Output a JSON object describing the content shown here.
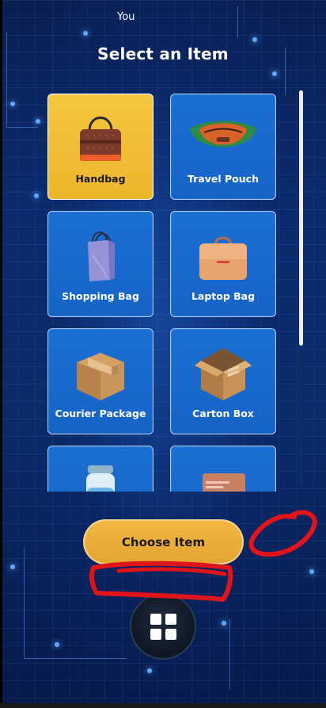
{
  "header": {
    "user_label": "You",
    "title": "Select an Item"
  },
  "items": [
    {
      "label": "Handbag",
      "selected": true,
      "icon": "handbag-icon"
    },
    {
      "label": "Travel Pouch",
      "selected": false,
      "icon": "travel-pouch-icon"
    },
    {
      "label": "Shopping Bag",
      "selected": false,
      "icon": "shopping-bag-icon"
    },
    {
      "label": "Laptop Bag",
      "selected": false,
      "icon": "laptop-bag-icon"
    },
    {
      "label": "Courier Package",
      "selected": false,
      "icon": "courier-package-icon"
    },
    {
      "label": "Carton Box",
      "selected": false,
      "icon": "carton-box-icon"
    },
    {
      "label": "",
      "selected": false,
      "icon": "jar-icon"
    },
    {
      "label": "",
      "selected": false,
      "icon": "envelope-icon"
    }
  ],
  "actions": {
    "choose_label": "Choose Item",
    "menu_icon": "grid-icon"
  },
  "colors": {
    "tile": "#1b6fd2",
    "tile_selected": "#f5c63f",
    "choose_button": "#efb13b",
    "annotation": "#e0151b"
  }
}
